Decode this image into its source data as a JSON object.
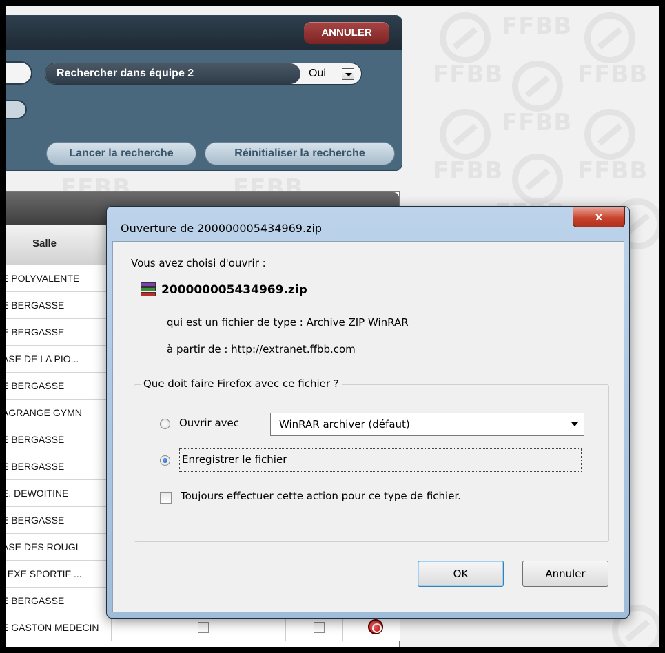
{
  "watermark": {
    "text": "FFBB"
  },
  "search_panel": {
    "cancel_label": "ANNULER",
    "criterion_label": "Rechercher dans équipe 2",
    "criterion_value": "Oui",
    "launch_label": "Lancer la recherche",
    "reset_label": "Réinitialiser la recherche"
  },
  "results": {
    "column_header": "Salle",
    "rows": [
      "E POLYVALENTE",
      "E BERGASSE",
      "E BERGASSE",
      "ASE DE LA PIO...",
      "E BERGASSE",
      "AGRANGE GYMN",
      "E BERGASSE",
      "E BERGASSE",
      "E. DEWOITINE",
      "E BERGASSE",
      "ASE DES ROUGI",
      "LEXE SPORTIF ...",
      "E BERGASSE",
      "E GASTON MEDECIN"
    ]
  },
  "dialog": {
    "title": "Ouverture de 200000005434969.zip",
    "close_label": "x",
    "intro": "Vous avez choisi d'ouvrir :",
    "file_icon": "winrar-archive-icon",
    "filename": "200000005434969.zip",
    "type_line": "qui est un fichier de type :  Archive ZIP WinRAR",
    "from_line": "à partir de :  http://extranet.ffbb.com",
    "group_title": "Que doit faire Firefox avec ce fichier ?",
    "open_with_label": "Ouvrir avec",
    "open_with_app": "WinRAR archiver (défaut)",
    "save_label": "Enregistrer le fichier",
    "always_label": "Toujours effectuer cette action pour ce type de fichier.",
    "ok_label": "OK",
    "cancel_label": "Annuler"
  }
}
